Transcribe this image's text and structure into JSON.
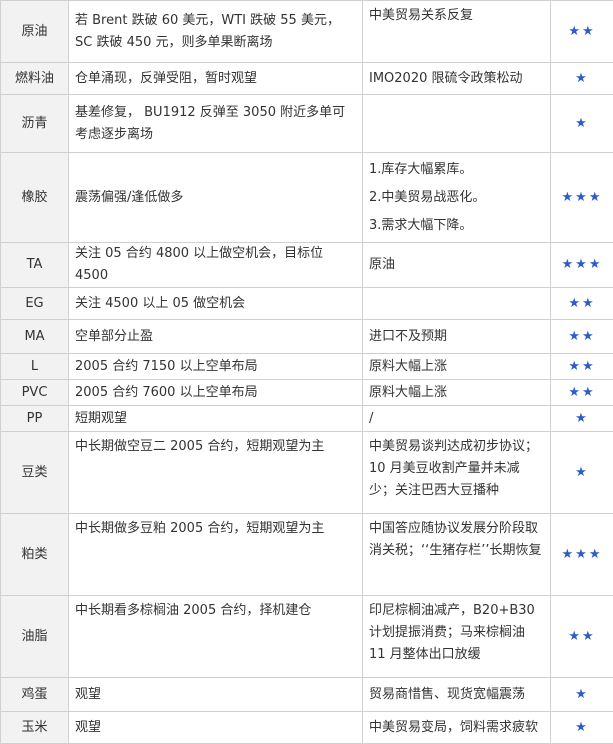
{
  "colors": {
    "star": "#2d5cc9",
    "name_bg": "#f2f2f2",
    "border": "#d0d0d0"
  },
  "rows": [
    {
      "name": "原油",
      "strategy": "若 Brent 跌破 60 美元，WTI 跌破 55 美元，SC 跌破 450 元，则多单果断离场",
      "risk": [
        "中美贸易关系反复"
      ],
      "stars": "★★"
    },
    {
      "name": "燃料油",
      "strategy": "仓单涌现，反弹受阻，暂时观望",
      "risk": [
        "IMO2020 限硫令政策松动"
      ],
      "stars": "★"
    },
    {
      "name": "沥青",
      "strategy": "基差修复， BU1912 反弹至 3050 附近多单可考虑逐步离场",
      "risk": [],
      "stars": "★"
    },
    {
      "name": "橡胶",
      "strategy": "震荡偏强/逢低做多",
      "risk": [
        "1.库存大幅累库。",
        "2.中美贸易战恶化。",
        "3.需求大幅下降。"
      ],
      "stars": "★★★"
    },
    {
      "name": "TA",
      "strategy": "关注 05 合约 4800 以上做空机会，目标位 4500",
      "risk": [
        "原油"
      ],
      "stars": "★★★"
    },
    {
      "name": "EG",
      "strategy": "关注 4500 以上 05 做空机会",
      "risk": [],
      "stars": "★★"
    },
    {
      "name": "MA",
      "strategy": "空单部分止盈",
      "risk": [
        "进口不及预期"
      ],
      "stars": "★★"
    },
    {
      "name": "L",
      "strategy": "2005 合约 7150 以上空单布局",
      "risk": [
        "原料大幅上涨"
      ],
      "stars": "★★"
    },
    {
      "name": "PVC",
      "strategy": "2005 合约 7600 以上空单布局",
      "risk": [
        "原料大幅上涨"
      ],
      "stars": "★★"
    },
    {
      "name": "PP",
      "strategy": "短期观望",
      "risk": [
        "/"
      ],
      "stars": "★"
    },
    {
      "name": "豆类",
      "strategy": "中长期做空豆二 2005 合约，短期观望为主",
      "risk": [
        "中美贸易谈判达成初步协议；10 月美豆收割产量并未减少；关注巴西大豆播种"
      ],
      "stars": "★"
    },
    {
      "name": "粕类",
      "strategy": "中长期做多豆粕 2005 合约，短期观望为主",
      "risk": [
        "中国答应随协议发展分阶段取消关税；‘‘生猪存栏’’长期恢复"
      ],
      "stars": "★★★"
    },
    {
      "name": "油脂",
      "strategy": "中长期看多棕榈油 2005 合约，择机建仓",
      "risk": [
        "印尼棕榈油减产，B20+B30 计划提振消费；马来棕榈油 11 月整体出口放缓"
      ],
      "stars": "★★"
    },
    {
      "name": "鸡蛋",
      "strategy": "观望",
      "risk": [
        "贸易商惜售、现货宽幅震荡"
      ],
      "stars": "★"
    },
    {
      "name": "玉米",
      "strategy": "观望",
      "risk": [
        "中美贸易变局，饲料需求疲软"
      ],
      "stars": "★"
    }
  ]
}
